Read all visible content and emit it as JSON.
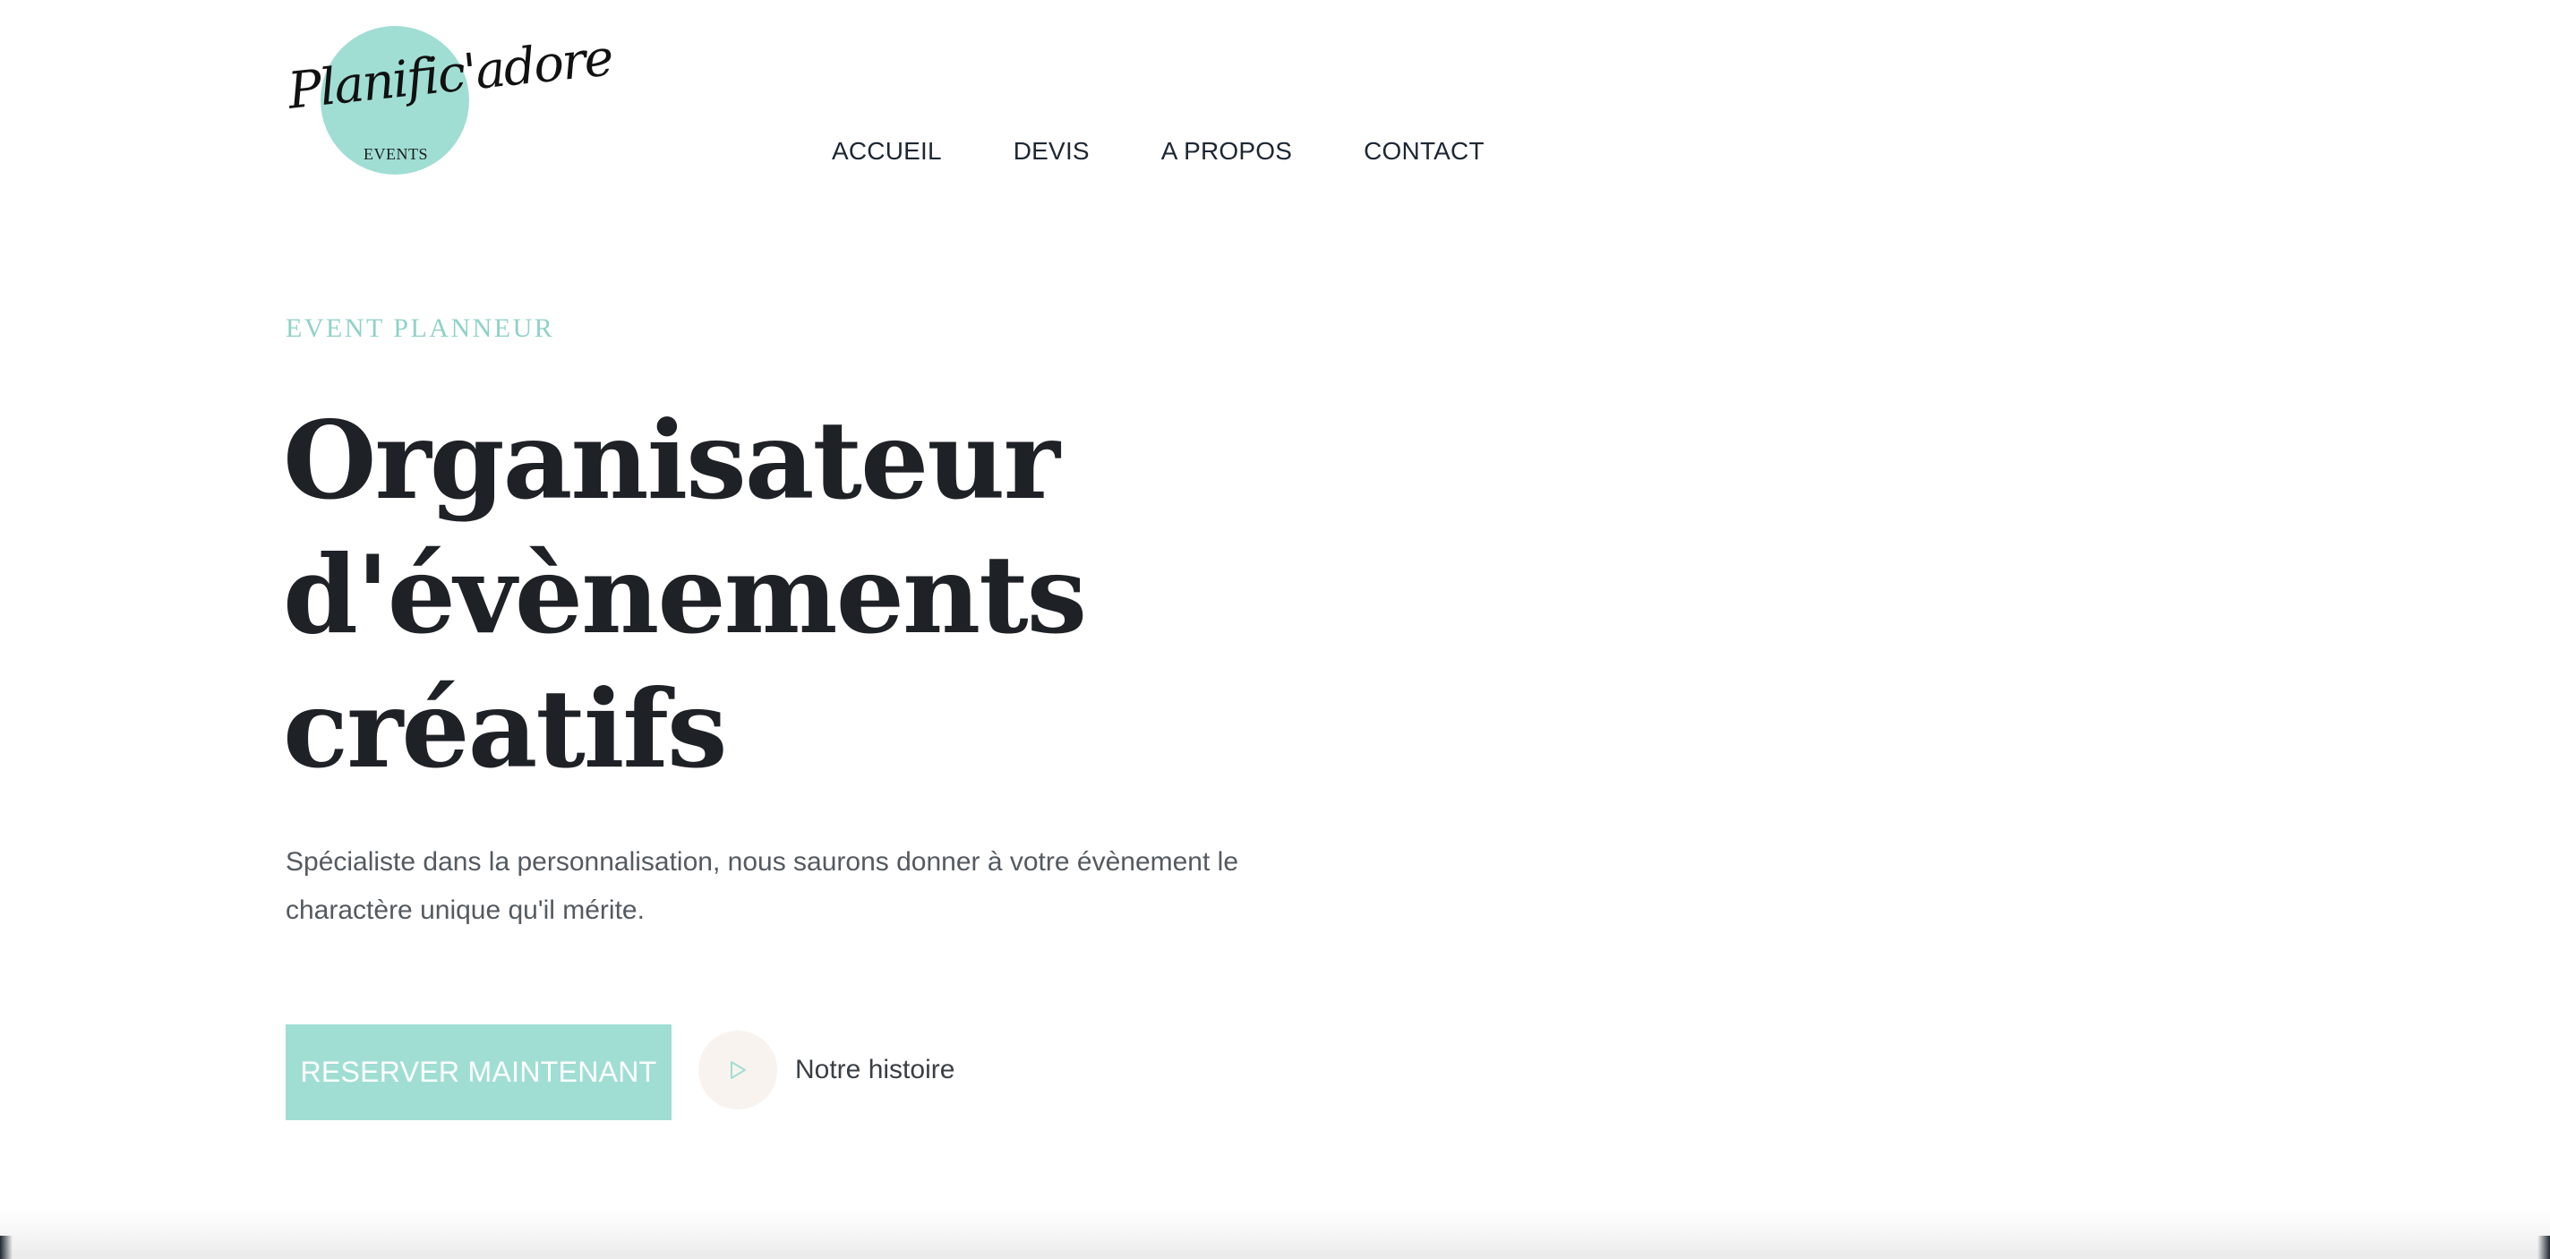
{
  "brand": {
    "logo_script": "Planific'adore",
    "logo_sub": "EVENTS",
    "circle_color": "#a0ded4"
  },
  "nav": {
    "items": [
      {
        "label": "ACCUEIL"
      },
      {
        "label": "DEVIS"
      },
      {
        "label": "A PROPOS"
      },
      {
        "label": "CONTACT"
      }
    ]
  },
  "hero": {
    "eyebrow": "EVENT PLANNEUR",
    "headline_lines": [
      "Organisateur",
      "d'évènements",
      "créatifs"
    ],
    "lead_line1": "Spécialiste dans la personnalisation, nous saurons donner à votre évènement le",
    "lead_line2": "charactère unique qu'il mérite.",
    "cta_label": "RESERVER MAINTENANT",
    "story_label": "Notre histoire",
    "story_icon": "play-icon"
  },
  "colors": {
    "accent": "#a0ded4",
    "eyebrow": "#8fd2c7",
    "heading": "#1e2226",
    "body_text": "#545a61",
    "play_bg": "#f8f3ee"
  }
}
